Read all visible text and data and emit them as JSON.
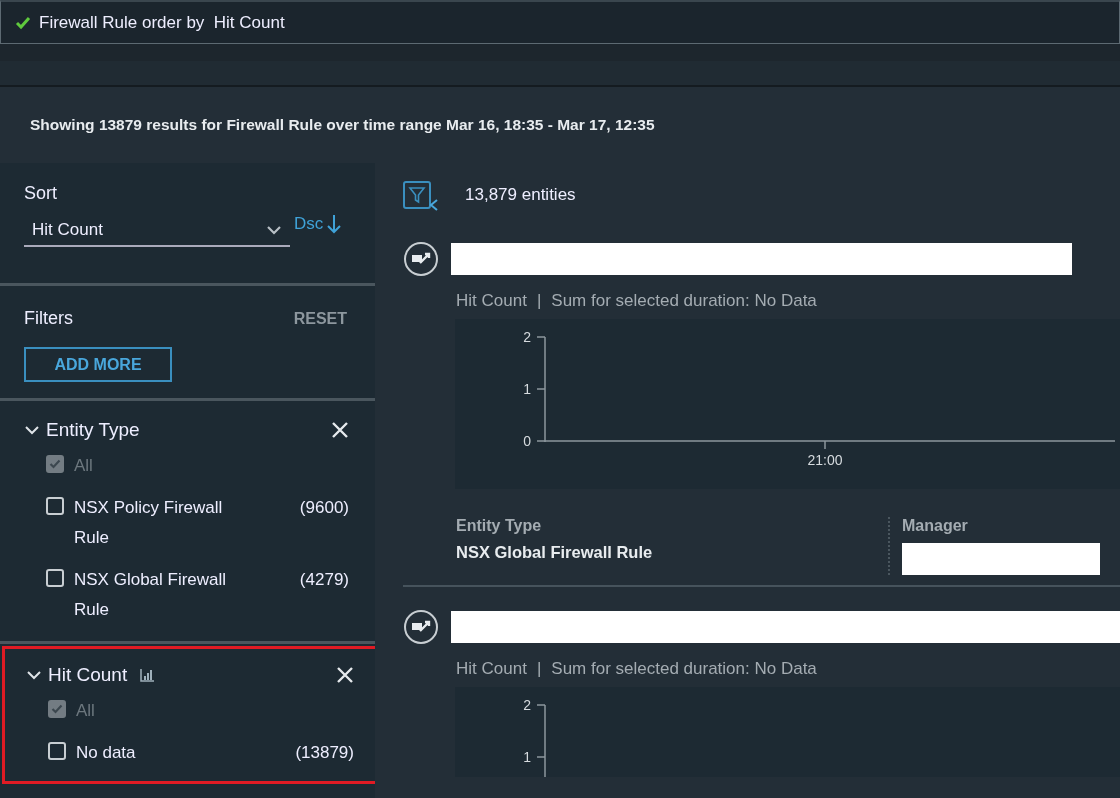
{
  "banner": {
    "text": "Firewall Rule order by  Hit Count"
  },
  "summary": {
    "prefix": "Showing 13879 results for Firewall Rule over time range Mar 16, 18:35 - Mar 17, 12:35"
  },
  "sidebar": {
    "sort": {
      "title": "Sort",
      "value": "Hit Count",
      "direction": "Dsc"
    },
    "filters": {
      "title": "Filters",
      "reset": "RESET",
      "add_more": "ADD MORE",
      "groups": [
        {
          "title": "Entity Type",
          "kind": "property",
          "expanded": true,
          "highlighted": false,
          "options": [
            {
              "label": "All",
              "checked": true,
              "disabled": true
            },
            {
              "label": "NSX Policy Firewall Rule",
              "count": "(9600)",
              "checked": false,
              "disabled": false
            },
            {
              "label": "NSX Global Firewall Rule",
              "count": "(4279)",
              "checked": false,
              "disabled": false
            }
          ]
        },
        {
          "title": "Hit Count",
          "kind": "metric",
          "expanded": true,
          "highlighted": true,
          "options": [
            {
              "label": "All",
              "checked": true,
              "disabled": true
            },
            {
              "label": "No data",
              "count": "(13879)",
              "checked": false,
              "disabled": false
            }
          ]
        }
      ]
    }
  },
  "results": {
    "count": "13,879 entities",
    "items": [
      {
        "metric": "Hit Count",
        "separator": "|",
        "summary": "Sum for selected duration: No Data",
        "y_axis_labels": [
          "2",
          "1",
          "0"
        ],
        "x_axis_labels": [
          "21:00"
        ],
        "properties": [
          {
            "label": "Entity Type",
            "value": "NSX Global Firewall Rule"
          },
          {
            "label": "Manager"
          }
        ]
      },
      {
        "metric": "Hit Count",
        "separator": "|",
        "summary": "Sum for selected duration: No Data",
        "y_axis_labels": [
          "2",
          "1"
        ]
      }
    ]
  }
}
